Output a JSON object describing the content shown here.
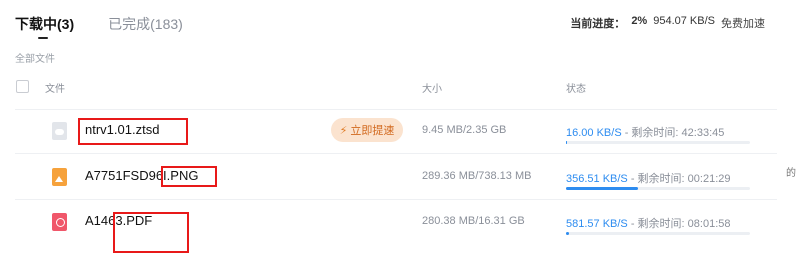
{
  "tabs": [
    {
      "label": "下载中(3)",
      "active": true
    },
    {
      "label": "已完成(183)",
      "active": false
    }
  ],
  "progress": {
    "label": "当前进度：",
    "percent": "2%",
    "speed": "954.07 KB/S",
    "speed_up": "免费加速"
  },
  "section_label": "全部文件",
  "columns": {
    "file": "文件",
    "size": "大小",
    "status": "状态"
  },
  "rows": [
    {
      "name": "ntrv1.01.ztsd",
      "icon": "generic-file-icon",
      "boost_label": "立即提速",
      "size": "9.45 MB/2.35 GB",
      "speed": "16.00 KB/S",
      "remaining": " - 剩余时间: 42:33:45",
      "progress": 0.004
    },
    {
      "name": "A7751FSD96I.PNG",
      "icon": "image-file-icon",
      "size": "289.36 MB/738.13 MB",
      "speed": "356.51 KB/S",
      "remaining": " - 剩余时间: 00:21:29",
      "progress": 0.39
    },
    {
      "name": "A1463.PDF",
      "icon": "pdf-file-icon",
      "size": "280.38 MB/16.31 GB",
      "speed": "581.57 KB/S",
      "remaining": " - 剩余时间: 08:01:58",
      "progress": 0.017
    }
  ],
  "edge_text": "的",
  "colors": {
    "accent": "#2d8cf0",
    "annotation": "#e81919",
    "boost_bg": "#fbe3cf",
    "boost_text": "#d2691e"
  }
}
